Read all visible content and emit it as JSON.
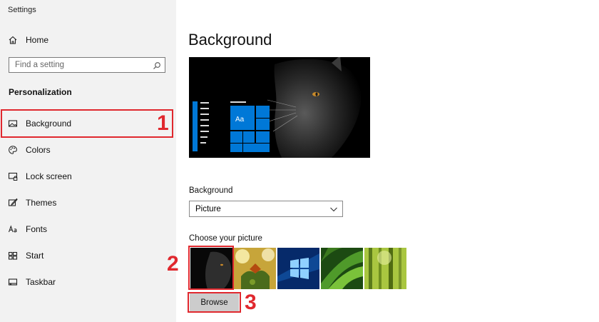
{
  "window": {
    "title": "Settings"
  },
  "sidebar": {
    "home_label": "Home",
    "search_placeholder": "Find a setting",
    "section_label": "Personalization",
    "items": [
      {
        "label": "Background",
        "icon": "picture-icon",
        "selected": true
      },
      {
        "label": "Colors",
        "icon": "palette-icon"
      },
      {
        "label": "Lock screen",
        "icon": "lock-screen-icon"
      },
      {
        "label": "Themes",
        "icon": "brush-icon"
      },
      {
        "label": "Fonts",
        "icon": "font-icon"
      },
      {
        "label": "Start",
        "icon": "start-grid-icon"
      },
      {
        "label": "Taskbar",
        "icon": "taskbar-icon"
      }
    ]
  },
  "main": {
    "title": "Background",
    "preview_tile_text": "Aa",
    "background_label": "Background",
    "background_value": "Picture",
    "choose_label": "Choose your picture",
    "browse_label": "Browse"
  },
  "annotations": {
    "step1": "1",
    "step2": "2",
    "step3": "3"
  },
  "colors": {
    "accent": "#0078d7",
    "annotation": "#e0282e",
    "sidebar_bg": "#f2f2f2",
    "button_bg": "#cccccc"
  }
}
